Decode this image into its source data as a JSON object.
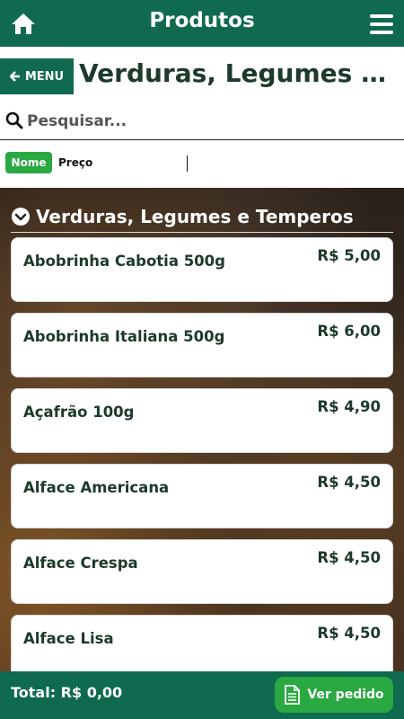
{
  "header": {
    "title": "Produtos",
    "home_icon": "home-icon",
    "menu_icon": "hamburger-menu-icon"
  },
  "subheader": {
    "back_label": "MENU",
    "section_title": "Verduras, Legumes e Temperos"
  },
  "search": {
    "placeholder": "Pesquisar...",
    "value": ""
  },
  "sort": {
    "active": "Nome",
    "other": "Preço"
  },
  "category": {
    "title": "Verduras, Legumes e Temperos",
    "icon": "chevron-down-circle-icon"
  },
  "products": [
    {
      "name": "Abobrinha Cabotia 500g",
      "price": "R$ 5,00"
    },
    {
      "name": "Abobrinha Italiana 500g",
      "price": "R$ 6,00"
    },
    {
      "name": "Açafrão 100g",
      "price": "R$ 4,90"
    },
    {
      "name": "Alface Americana",
      "price": "R$ 4,50"
    },
    {
      "name": "Alface Crespa",
      "price": "R$ 4,50"
    },
    {
      "name": "Alface Lisa",
      "price": "R$ 4,50"
    }
  ],
  "footer": {
    "total": "Total: R$ 0,00",
    "order_label": "Ver pedido",
    "order_icon": "document-icon"
  },
  "colors": {
    "primary": "#0f6a4f",
    "accent": "#2aa842",
    "text_dark": "#1d3a2b"
  }
}
